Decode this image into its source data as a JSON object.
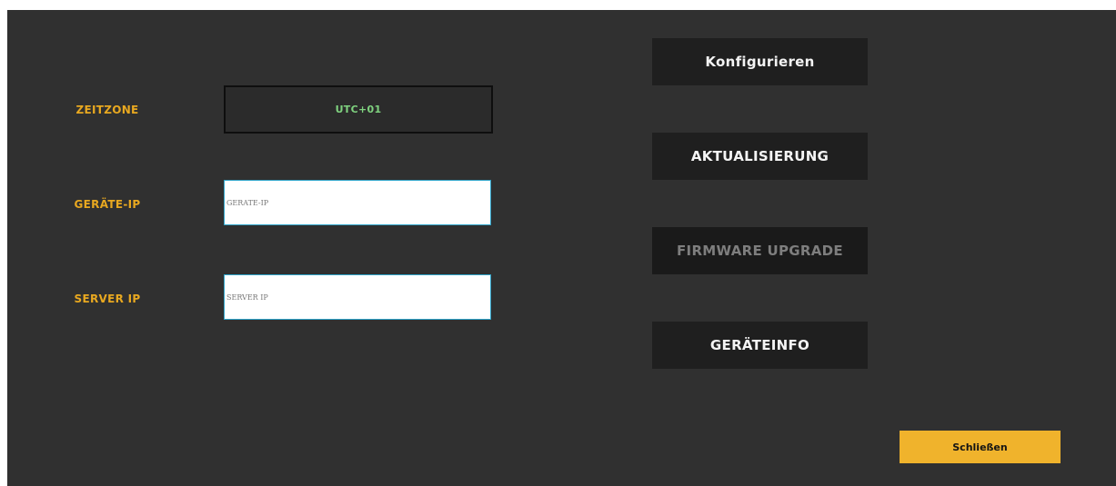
{
  "form": {
    "timezone_label": "ZEITZONE",
    "timezone_value": "UTC+01",
    "device_ip_label": "GERÄTE-IP",
    "device_ip_placeholder": "GERÄTE-IP",
    "device_ip_value": "",
    "server_ip_label": "SERVER IP",
    "server_ip_placeholder": "SERVER IP",
    "server_ip_value": ""
  },
  "actions": {
    "configure_label": "Konfigurieren",
    "update_label": "AKTUALISIERUNG",
    "firmware_label": "FIRMWARE UPGRADE",
    "firmware_enabled": false,
    "device_info_label": "GERÄTEINFO",
    "close_label": "Schließen"
  },
  "colors": {
    "background": "#303030",
    "label_accent": "#e8a820",
    "timezone_text": "#7fd27f",
    "button_bg": "#1f1f1f",
    "close_button_bg": "#f0b32c",
    "input_border": "#2fa3c8"
  }
}
